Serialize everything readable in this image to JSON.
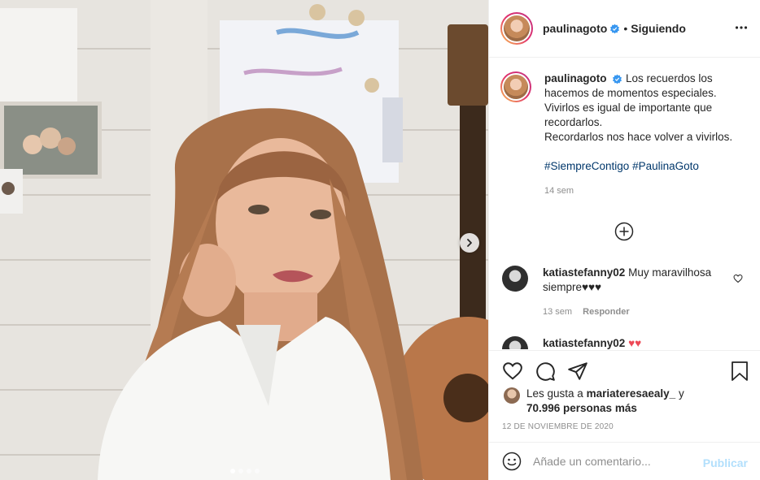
{
  "post": {
    "username": "paulinagoto",
    "follow_status": "Siguiendo",
    "header_separator": "•",
    "caption": {
      "lines": [
        "Los recuerdos los hacemos de momentos especiales.",
        "Vivirlos es igual de importante que recordarlos.",
        "Recordarlos nos hace volver a vivirlos."
      ],
      "hashtags": [
        "#SiempreContigo",
        "#PaulinaGoto"
      ],
      "time": "14 sem"
    },
    "carousel": {
      "slides": 4,
      "active_index": 0
    }
  },
  "comments": [
    {
      "username": "katiastefanny02",
      "text": "Muy maravilhosa siempre♥♥♥",
      "time": "13 sem",
      "reply_label": "Responder"
    },
    {
      "username": "katiastefanny02",
      "text": "♥♥",
      "time": "",
      "reply_label": ""
    }
  ],
  "likes": {
    "prefix": "Les gusta a",
    "user": "mariateresaealy_",
    "connector": "y",
    "count_text": "70.996 personas más"
  },
  "date": "12 DE NOVIEMBRE DE 2020",
  "comment_box": {
    "placeholder": "Añade un comentario...",
    "publish_label": "Publicar"
  },
  "icons": {
    "verified": "verified-badge-icon",
    "more": "more-options-icon",
    "load_more": "plus-circle-icon",
    "like": "heart-icon",
    "comment": "comment-icon",
    "share": "share-icon",
    "save": "bookmark-icon",
    "emoji": "emoji-icon",
    "next": "chevron-right-icon"
  },
  "colors": {
    "verified": "#3897f0",
    "link": "#00376b",
    "muted": "#8e8e8e",
    "publish_disabled": "#b2dffc",
    "comment_heart": "#ed4956"
  }
}
